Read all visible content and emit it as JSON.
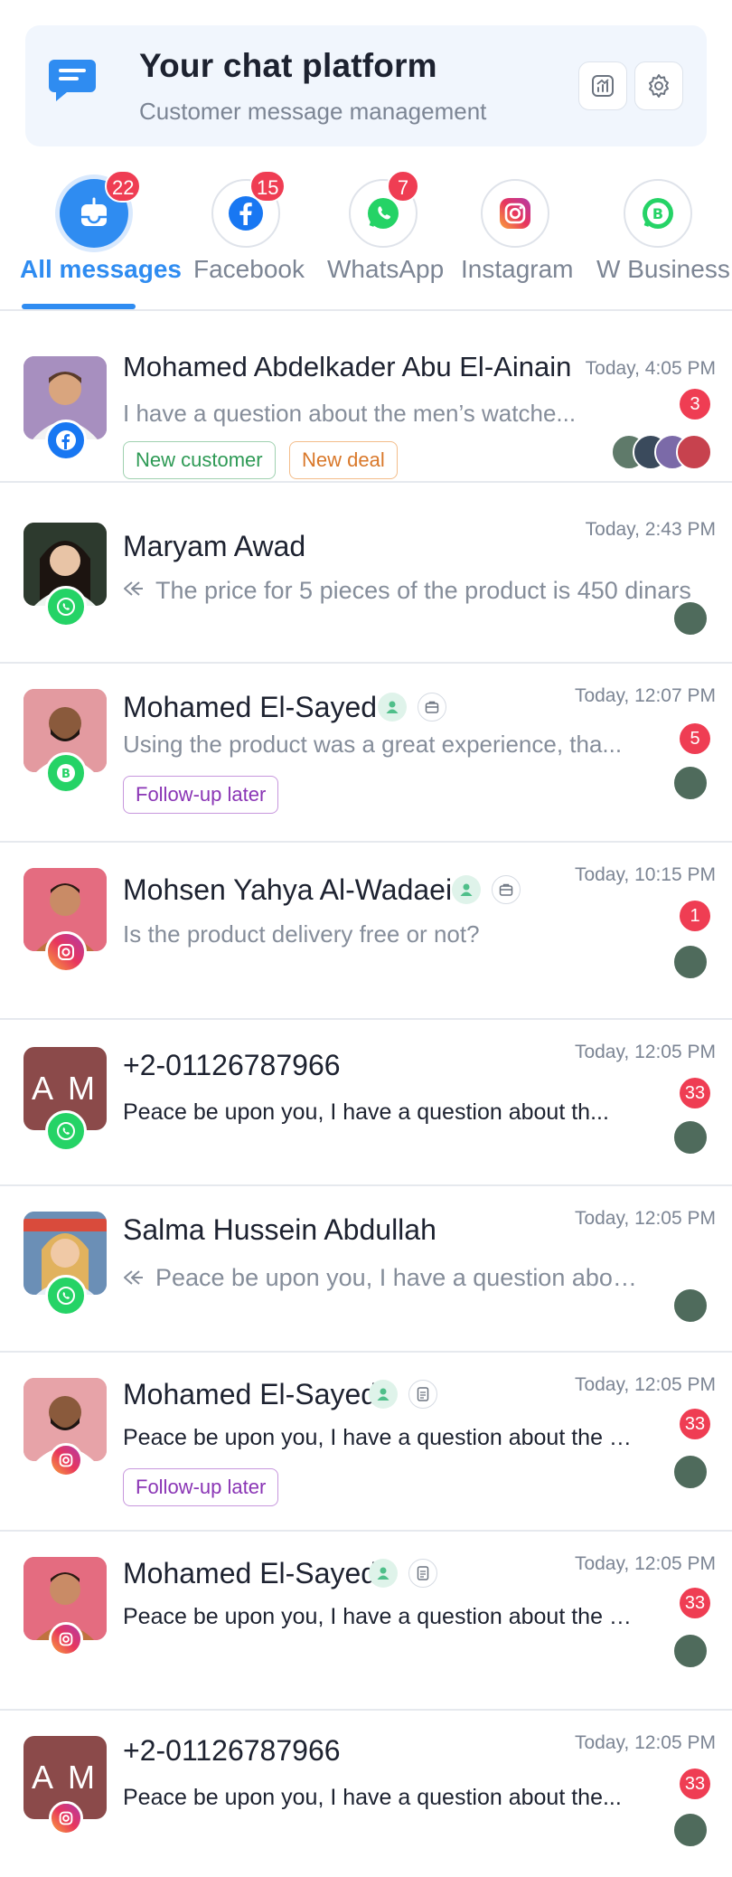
{
  "header": {
    "title": "Your chat platform",
    "subtitle": "Customer message management",
    "logo_icon": "chat-bubble-icon",
    "stats_icon": "chart-icon",
    "settings_icon": "gear-icon"
  },
  "tabs": [
    {
      "label": "All messages",
      "badge": "22",
      "icon": "inbox-icon",
      "active": true
    },
    {
      "label": "Facebook",
      "badge": "15",
      "icon": "facebook-icon"
    },
    {
      "label": "WhatsApp",
      "badge": "7",
      "icon": "whatsapp-icon"
    },
    {
      "label": "Instagram",
      "badge": "",
      "icon": "instagram-icon"
    },
    {
      "label": "W Business",
      "badge": "",
      "icon": "whatsapp-business-icon"
    }
  ],
  "conversations": [
    {
      "name": "Mohamed Abdelkader Abu El-Ainain",
      "time": "Today, 4:05 PM",
      "preview": "I have a question about the men’s watche...",
      "unread": "3",
      "channel": "facebook",
      "tags": [
        "New customer",
        "New deal"
      ]
    },
    {
      "name": "Maryam Awad",
      "time": "Today, 2:43 PM",
      "preview": "The price for 5 pieces of the product is 450 dinars",
      "unread": "",
      "channel": "whatsapp",
      "replied": true
    },
    {
      "name": "Mohamed El-Sayed",
      "time": "Today, 12:07 PM",
      "preview": "Using the product was a great experience, tha...",
      "unread": "5",
      "channel": "whatsapp-business",
      "tags": [
        "Follow-up later"
      ]
    },
    {
      "name": "Mohsen Yahya Al-Wadaei",
      "time": "Today, 10:15 PM",
      "preview": "Is the product delivery free or not?",
      "unread": "1",
      "channel": "instagram"
    },
    {
      "name": "+2-01126787966",
      "initials": "A M",
      "time": "Today, 12:05 PM",
      "preview": "Peace be upon you, I have a question about th...",
      "unread": "33",
      "channel": "whatsapp"
    },
    {
      "name": "Salma Hussein Abdullah",
      "time": "Today, 12:05 PM",
      "preview": "Peace be upon you, I have a question about...",
      "unread": "",
      "channel": "whatsapp",
      "replied": true
    },
    {
      "name": "Mohamed El-Sayed",
      "time": "Today, 12:05 PM",
      "preview": "Peace be upon you, I have a question about the av...",
      "unread": "33",
      "channel": "instagram",
      "tags": [
        "Follow-up later"
      ]
    },
    {
      "name": "Mohamed El-Sayed",
      "time": "Today, 12:05 PM",
      "preview": "Peace be upon you, I have a question about the a...",
      "unread": "33",
      "channel": "instagram"
    },
    {
      "name": "+2-01126787966",
      "initials": "A M",
      "time": "Today, 12:05 PM",
      "preview": "Peace be upon you, I have a question about the...",
      "unread": "33",
      "channel": "instagram"
    }
  ],
  "colors": {
    "accent": "#2f8cf1",
    "badge_red": "#ef3d53",
    "facebook": "#1877f2",
    "whatsapp": "#25d366",
    "instagram_from": "#f9a23b",
    "instagram_to": "#c1368e"
  }
}
